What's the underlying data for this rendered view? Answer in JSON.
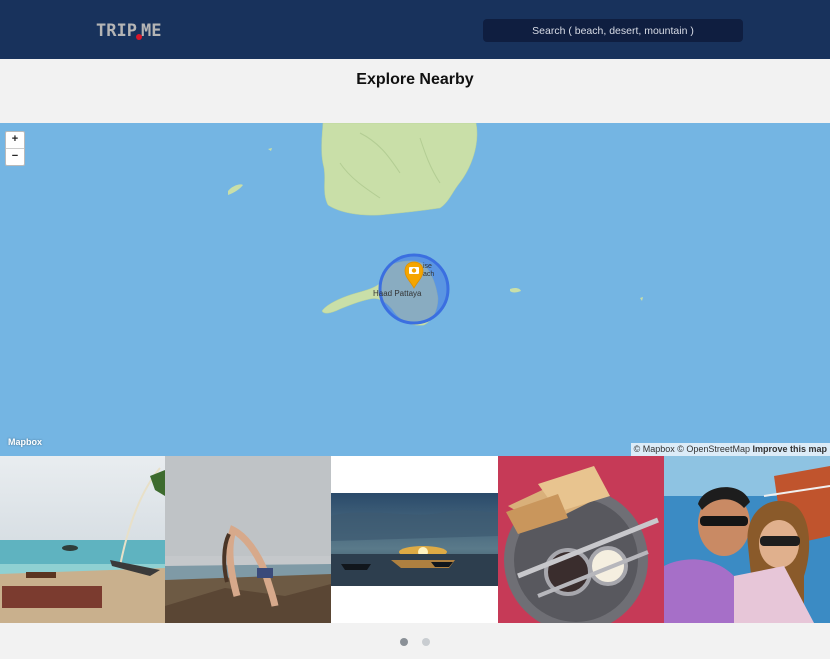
{
  "header": {
    "logo_text_left": "TRIP",
    "logo_text_right": "ME",
    "search_placeholder": "Search ( beach, desert, mountain )"
  },
  "page_title": "Explore Nearby",
  "map": {
    "zoom_in_label": "+",
    "zoom_out_label": "−",
    "place_label": "Haad Pattaya",
    "place_label_partial": "ise\nach",
    "provider_logo": "Mapbox",
    "attribution_mapbox": "© Mapbox",
    "attribution_osm": "© OpenStreetMap",
    "attribution_improve": "Improve this map",
    "marker_icon": "camera-pin-icon",
    "colors": {
      "water": "#74b5e3",
      "land": "#c9dfa8",
      "marker": "#f5a500",
      "radius": "#3b6fe0"
    }
  },
  "photos": [
    {
      "name": "beach-swing-photo"
    },
    {
      "name": "yoga-pose-photo"
    },
    {
      "name": "sunset-boats-photo"
    },
    {
      "name": "breakfast-toast-photo"
    },
    {
      "name": "couple-selfie-photo"
    }
  ],
  "carousel": {
    "pages": 2,
    "active_page": 1
  }
}
